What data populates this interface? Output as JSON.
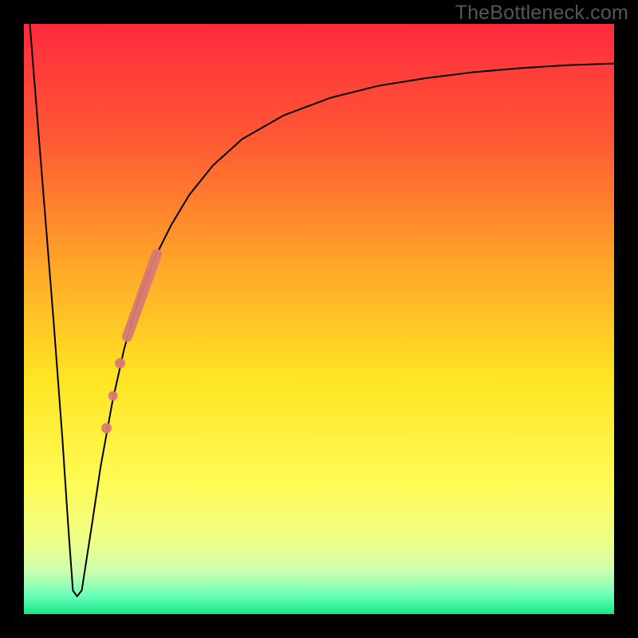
{
  "watermark": "TheBottleneck.com",
  "chart_data": {
    "type": "line",
    "title": "",
    "xlabel": "",
    "ylabel": "",
    "xlim": [
      0,
      100
    ],
    "ylim": [
      0,
      100
    ],
    "background_gradient": {
      "stops": [
        {
          "offset": 0.0,
          "color": "#ff2a3e"
        },
        {
          "offset": 0.2,
          "color": "#ff5a33"
        },
        {
          "offset": 0.4,
          "color": "#ffa329"
        },
        {
          "offset": 0.6,
          "color": "#ffe423"
        },
        {
          "offset": 0.78,
          "color": "#fffb55"
        },
        {
          "offset": 0.88,
          "color": "#eeff8a"
        },
        {
          "offset": 0.93,
          "color": "#c7ffb0"
        },
        {
          "offset": 0.97,
          "color": "#66ffb8"
        },
        {
          "offset": 1.0,
          "color": "#18e685"
        }
      ]
    },
    "series": [
      {
        "name": "bottleneck-curve",
        "x": [
          1.0,
          3.0,
          5.0,
          6.5,
          7.5,
          8.3,
          9.0,
          9.8,
          11.5,
          13.0,
          15.0,
          17.0,
          19.0,
          22.0,
          25.0,
          28.0,
          32.0,
          37.0,
          44.0,
          52.0,
          60.0,
          68.0,
          76.0,
          84.0,
          92.0,
          100.0
        ],
        "y": [
          100.0,
          75.0,
          50.0,
          30.0,
          15.0,
          4.0,
          3.0,
          4.0,
          15.0,
          25.0,
          36.0,
          45.0,
          52.0,
          60.0,
          66.0,
          71.0,
          76.0,
          80.5,
          84.5,
          87.5,
          89.5,
          90.8,
          91.8,
          92.5,
          93.0,
          93.3
        ],
        "stroke": "#000000",
        "stroke_width": 2
      }
    ],
    "highlight_segment": {
      "name": "marked-range",
      "color": "#d97a74",
      "bar": {
        "x1": 17.5,
        "y1": 47.0,
        "x2": 22.5,
        "y2": 61.0,
        "width": 13
      },
      "dots": [
        {
          "x": 16.3,
          "y": 42.5,
          "r": 6.5
        },
        {
          "x": 15.1,
          "y": 37.0,
          "r": 6.0
        },
        {
          "x": 14.0,
          "y": 31.5,
          "r": 6.5
        }
      ]
    }
  }
}
